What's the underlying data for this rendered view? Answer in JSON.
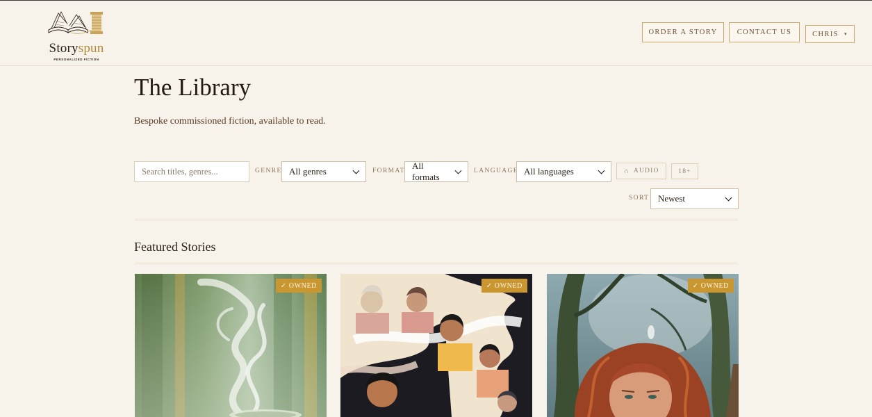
{
  "header": {
    "logo_word_1": "Story",
    "logo_word_2": "spun",
    "logo_tagline": "PERSONALIZED FICTION",
    "order_label": "ORDER A STORY",
    "contact_label": "CONTACT US",
    "user_label": "CHRIS",
    "user_caret": "▾"
  },
  "page": {
    "title": "The Library",
    "subtitle": "Bespoke commissioned fiction, available to read."
  },
  "filters": {
    "search_placeholder": "Search titles, genres...",
    "genre_label": "GENRE",
    "genre_value": "All genres",
    "format_label": "FORMAT",
    "format_value": "All formats",
    "language_label": "LANGUAGE",
    "language_value": "All languages",
    "audio_label": "AUDIO",
    "adult_label": "18+",
    "sort_label": "SORT",
    "sort_value": "Newest"
  },
  "featured": {
    "title": "Featured Stories",
    "cards": [
      {
        "badge": "✓ OWNED",
        "art": "steaming-cup-forest"
      },
      {
        "badge": "✓ OWNED",
        "art": "women-generations"
      },
      {
        "badge": "✓ OWNED",
        "art": "red-haired-woman-forest"
      }
    ]
  },
  "colors": {
    "background": "#f8f3ea",
    "accent_gold": "#c9962f",
    "border_gold": "#c9a86a",
    "text_dark": "#2b211a"
  }
}
